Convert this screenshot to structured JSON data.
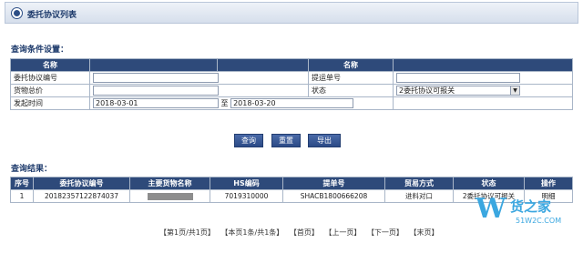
{
  "header": {
    "title": "委托协议列表"
  },
  "query": {
    "section_label": "查询条件设置：",
    "headers": [
      "名称",
      "名称"
    ],
    "rows": [
      {
        "label": "委托协议编号",
        "value": "",
        "label2": "提运单号",
        "value2": ""
      },
      {
        "label": "货物总价",
        "value": "",
        "label2": "状态",
        "value2": "2委托协议可报关"
      },
      {
        "label": "发起时间",
        "value": "2018-03-01",
        "sep": "至",
        "value2": "2018-03-20"
      }
    ]
  },
  "buttons": {
    "search": "查询",
    "reset": "重置",
    "export": "导出"
  },
  "results": {
    "section_label": "查询结果：",
    "columns": [
      "序号",
      "委托协议编号",
      "主要货物名称",
      "HS编码",
      "提单号",
      "贸易方式",
      "状态",
      "操作"
    ],
    "rows": [
      {
        "no": "1",
        "agreement_no": "20182357122874037",
        "goods_name": "",
        "hs_code": "7019310000",
        "bill_no": "SHACB1800666208",
        "trade_mode": "进料对口",
        "status": "2委托协议可报关",
        "action": "明细"
      }
    ]
  },
  "pager": {
    "page_info": "【第1页/共1页】",
    "count_info": "【本页1条/共1条】",
    "first": "【首页】",
    "prev": "【上一页】",
    "next": "【下一页】",
    "last": "【末页】"
  },
  "watermark": {
    "logo_letter": "W",
    "text": "货之家",
    "url": "51W2C.COM"
  },
  "colors": {
    "header_bg": "#2e4a7a",
    "accent": "#1d3a6b",
    "watermark": "#3ba7e0"
  }
}
